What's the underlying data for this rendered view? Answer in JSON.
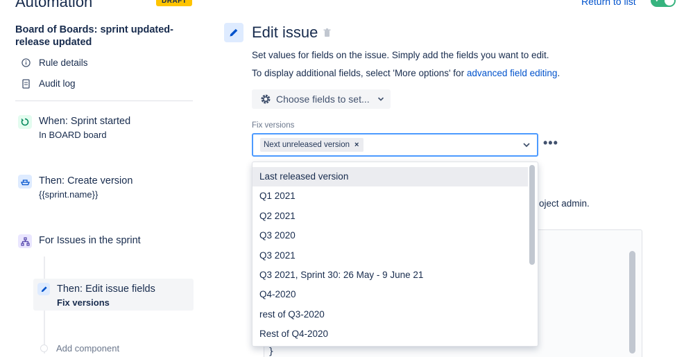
{
  "header": {
    "title": "Automation",
    "draft_badge": "DRAFT",
    "return_link": "Return to list"
  },
  "sidebar": {
    "rule_title": "Board of Boards: sprint updated-release updated",
    "links": [
      {
        "label": "Rule details",
        "icon": "info-icon"
      },
      {
        "label": "Audit log",
        "icon": "document-icon"
      }
    ],
    "steps": [
      {
        "title": "When: Sprint started",
        "subtitle": "In BOARD board",
        "icon": "sprint-trigger-icon"
      },
      {
        "title": "Then: Create version",
        "subtitle": "{{sprint.name}}",
        "icon": "ship-icon"
      },
      {
        "title": "For Issues in the sprint",
        "subtitle": "",
        "icon": "branch-icon"
      },
      {
        "title": "Then: Edit issue fields",
        "subtitle": "Fix versions",
        "icon": "pencil-icon"
      }
    ],
    "add_component": "Add component"
  },
  "main": {
    "title": "Edit issue",
    "desc1": "Set values for fields on the issue. Simply add the fields you want to edit.",
    "desc2_prefix": "To display additional fields, select 'More options' for ",
    "desc2_link": "advanced field editing",
    "desc2_suffix": ".",
    "choose_fields": "Choose fields to set...",
    "field_label": "Fix versions",
    "selected_tag": "Next unreleased version",
    "more": "•••",
    "behind_text": "oject admin.",
    "behind_brace": "}",
    "options": [
      "Last released version",
      "Q1 2021",
      "Q2 2021",
      "Q3 2020",
      "Q3 2021",
      "Q3 2021, Sprint 30: 26 May - 9 June 21",
      "Q4-2020",
      "rest of Q3-2020",
      "Rest of Q4-2020"
    ]
  },
  "colors": {
    "accent": "#0052cc",
    "focus_border": "#4c9aff",
    "draft": "#ffc400",
    "toggle_on": "#36b37e"
  }
}
